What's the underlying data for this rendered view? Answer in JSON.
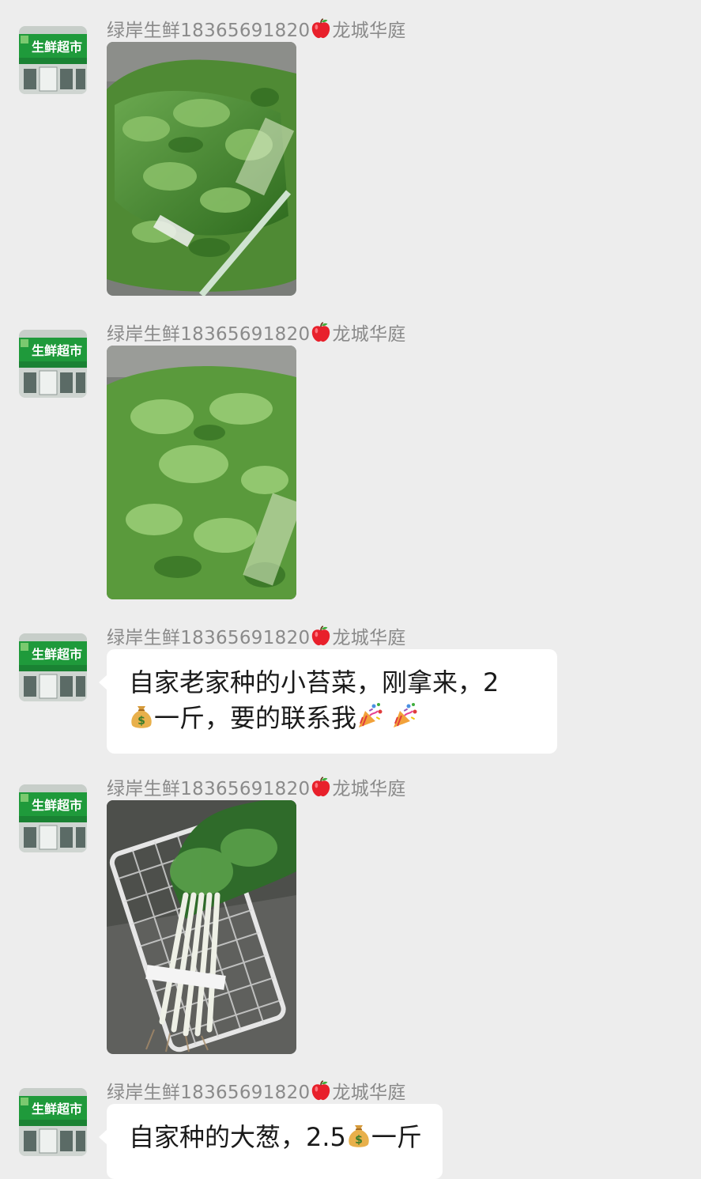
{
  "chat": {
    "messages": [
      {
        "sender": "绿岸生鲜18365691820",
        "location": "龙城华庭",
        "type": "image",
        "image": "leafy-greens-photo"
      },
      {
        "sender": "绿岸生鲜18365691820",
        "location": "龙城华庭",
        "type": "image",
        "image": "leafy-greens-photo"
      },
      {
        "sender": "绿岸生鲜18365691820",
        "location": "龙城华庭",
        "type": "text",
        "line1": "自家老家种的小苔菜，刚拿来，2",
        "line2_a": "一斤，要的联系我"
      },
      {
        "sender": "绿岸生鲜18365691820",
        "location": "龙城华庭",
        "type": "image",
        "image": "scallions-in-basket-photo"
      },
      {
        "sender": "绿岸生鲜18365691820",
        "location": "龙城华庭",
        "type": "text",
        "text_a": "自家种的大葱，2.5",
        "text_b": "一斤"
      }
    ]
  },
  "avatar_sign": "生鲜超市",
  "colors": {
    "background": "#ededed",
    "bubble": "#ffffff",
    "sender_text": "#8a8a8a",
    "sign_green": "#1f9a3b"
  },
  "icons": {
    "apple": "apple-icon",
    "money_bag": "money-bag-icon",
    "party": "party-popper-icon"
  }
}
